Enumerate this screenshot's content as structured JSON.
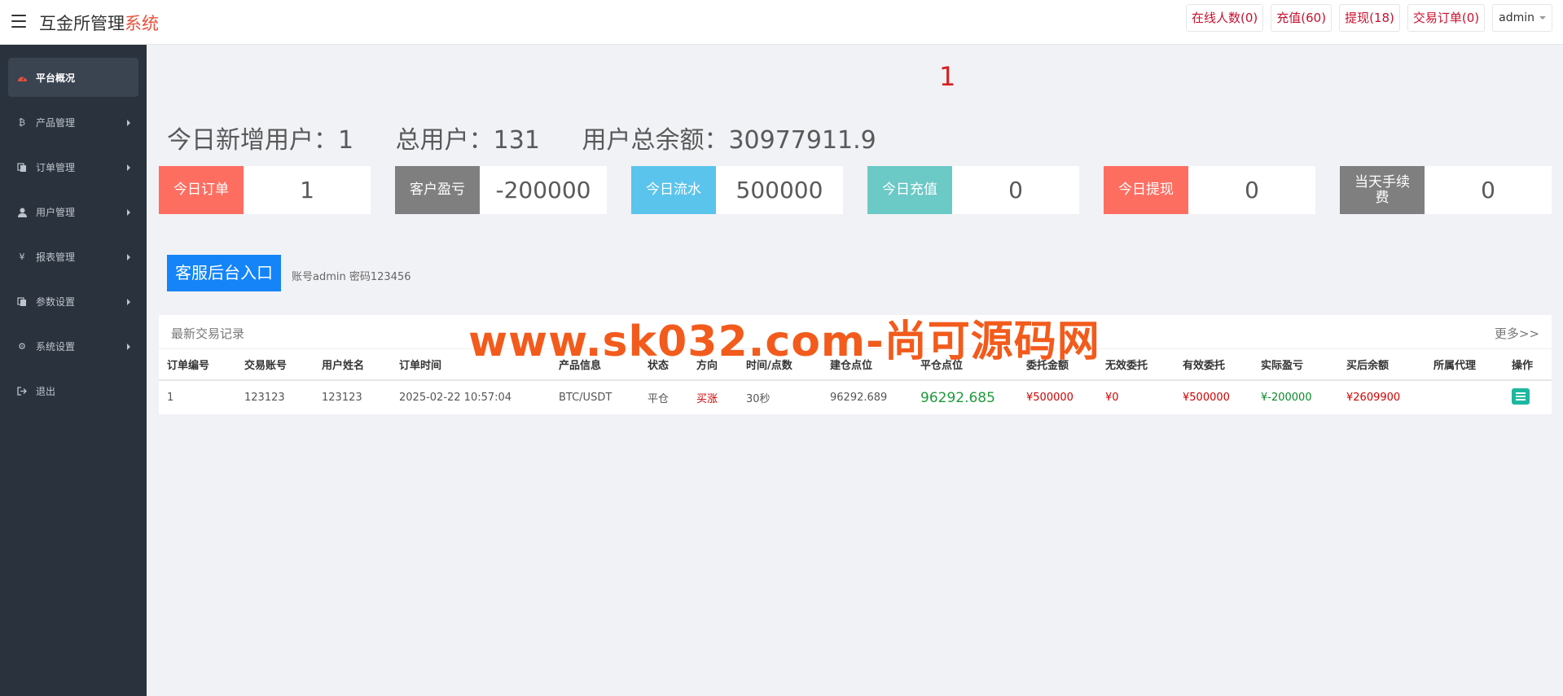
{
  "header": {
    "brand_main": "互金所管理",
    "brand_accent": "系统",
    "buttons": [
      "在线人数(0)",
      "充值(60)",
      "提现(18)",
      "交易订单(0)"
    ],
    "user": "admin"
  },
  "sidebar": {
    "items": [
      {
        "label": "平台概况",
        "icon": "dashboard-icon"
      },
      {
        "label": "产品管理",
        "icon": "bitcoin-icon"
      },
      {
        "label": "订单管理",
        "icon": "copy-icon"
      },
      {
        "label": "用户管理",
        "icon": "user-icon"
      },
      {
        "label": "报表管理",
        "icon": "yen-icon"
      },
      {
        "label": "参数设置",
        "icon": "copy-icon"
      },
      {
        "label": "系统设置",
        "icon": "gears-icon"
      },
      {
        "label": "退出",
        "icon": "logout-icon"
      }
    ]
  },
  "main": {
    "red_number": "1",
    "stats": {
      "new_users": "今日新增用户：1",
      "total_users": "总用户：131",
      "total_balance": "用户总余额：30977911.9"
    },
    "cards": [
      {
        "label": "今日订单",
        "value": "1",
        "color": "#fd6e61"
      },
      {
        "label": "客户盈亏",
        "value": "-200000",
        "color": "#7f7f7f"
      },
      {
        "label": "今日流水",
        "value": "500000",
        "color": "#5bc4ec"
      },
      {
        "label": "今日充值",
        "value": "0",
        "color": "#6bc9c6"
      },
      {
        "label": "今日提现",
        "value": "0",
        "color": "#fd6e61"
      },
      {
        "label": "当天手续费",
        "value": "0",
        "color": "#7f7f7f"
      }
    ],
    "cs_button": "客服后台入口",
    "cs_note": "账号admin 密码123456",
    "panel_title": "最新交易记录",
    "panel_more": "更多>>",
    "watermark": "www.sk032.com-尚可源码网",
    "table": {
      "columns": [
        "订单编号",
        "交易账号",
        "用户姓名",
        "订单时间",
        "产品信息",
        "状态",
        "方向",
        "时间/点数",
        "建仓点位",
        "平仓点位",
        "委托金额",
        "无效委托",
        "有效委托",
        "实际盈亏",
        "买后余额",
        "所属代理",
        "操作"
      ],
      "rows": [
        [
          "1",
          "123123",
          "123123",
          "2025-02-22 10:57:04",
          "BTC/USDT",
          "平仓",
          "买涨",
          "30秒",
          "96292.689",
          "96292.685",
          "¥500000",
          "¥0",
          "¥500000",
          "¥-200000",
          "¥2609900",
          "",
          ""
        ]
      ]
    }
  }
}
